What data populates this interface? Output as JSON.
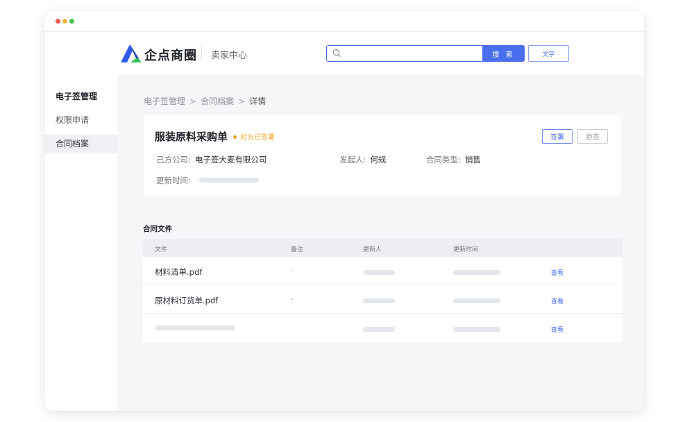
{
  "window": {
    "controls": [
      "close",
      "minimize",
      "maximize"
    ]
  },
  "header": {
    "brand": "企点商圈",
    "subtitle": "卖家中心",
    "search": {
      "placeholder": "",
      "value": ""
    },
    "search_button": "搜 索",
    "text_button": "文字"
  },
  "sidebar": {
    "title": "电子签管理",
    "items": [
      {
        "label": "权限申请",
        "active": false
      },
      {
        "label": "合同档案",
        "active": true
      }
    ]
  },
  "breadcrumb": [
    "电子签管理",
    "合同档案",
    "详情"
  ],
  "contract": {
    "title": "服装原料采购单",
    "status": "对方已签署",
    "sign_button": "签署",
    "reject_button": "拒签",
    "fields": {
      "company_label": "己方公司:",
      "company_value": "电子签大麦有限公司",
      "initiator_label": "发起人:",
      "initiator_value": "何规",
      "type_label": "合同类型:",
      "type_value": "销售",
      "updated_label": "更新时间:"
    }
  },
  "files": {
    "section_title": "合同文件",
    "columns": [
      "文件",
      "备注",
      "更新人",
      "更新时间"
    ],
    "rows": [
      {
        "file": "材料清单.pdf",
        "note": "-",
        "action": "查看"
      },
      {
        "file": "原材料订货单.pdf",
        "note": "-",
        "action": "查看"
      },
      {
        "file": "",
        "note": "",
        "action": "查看"
      }
    ]
  },
  "colors": {
    "accent": "#4a6ef0",
    "status": "#f5a623",
    "logo_blue": "#2f5bea",
    "logo_green": "#34c25a"
  }
}
